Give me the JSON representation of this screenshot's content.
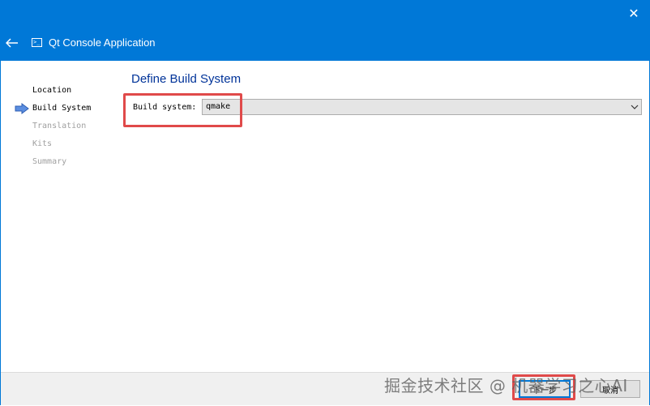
{
  "window": {
    "title": "Qt Console Application",
    "close_glyph": "✕",
    "icon": "console-app-icon",
    "icon_glyph": ">_"
  },
  "steps": [
    {
      "label": "Location",
      "state": "done"
    },
    {
      "label": "Build System",
      "state": "current"
    },
    {
      "label": "Translation",
      "state": "todo"
    },
    {
      "label": "Kits",
      "state": "todo"
    },
    {
      "label": "Summary",
      "state": "todo"
    }
  ],
  "page": {
    "title": "Define Build System",
    "build_system_label": "Build system:",
    "build_system_value": "qmake"
  },
  "buttons": {
    "next_label": "下一步",
    "cancel_label": "取消"
  },
  "watermark": "掘金技术社区 @ 机器学习之心AI",
  "colors": {
    "titlebar": "#0078d7",
    "page_title": "#003399",
    "highlight": "#e04a4a",
    "step_arrow": "#3c78d8"
  }
}
